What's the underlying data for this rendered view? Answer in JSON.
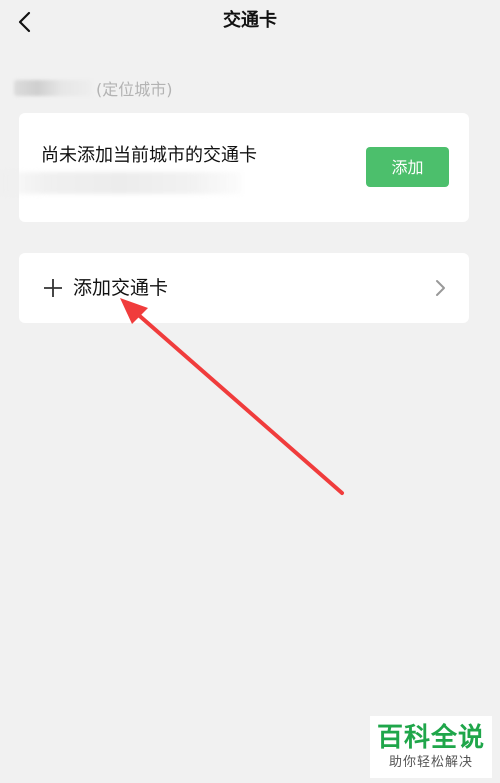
{
  "header": {
    "title": "交通卡"
  },
  "location": {
    "label": "(定位城市)"
  },
  "current_city_card": {
    "message": "尚未添加当前城市的交通卡",
    "add_button_label": "添加"
  },
  "add_card_row": {
    "label": "添加交通卡"
  },
  "watermark": {
    "main": "百科全说",
    "sub": "助你轻松解决"
  },
  "colors": {
    "accent_green": "#4cbf6c",
    "annotation_red": "#f03c3c",
    "watermark_green": "#1fa64a"
  }
}
